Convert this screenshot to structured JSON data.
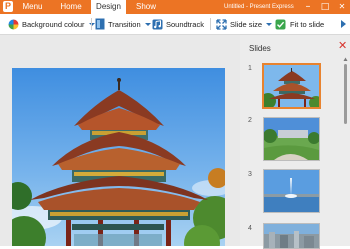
{
  "app": {
    "icon_letter": "P",
    "window_title": "Untitled - Present Express",
    "accent": "#ec7424"
  },
  "menu": {
    "tabs": [
      {
        "label": "Menu"
      },
      {
        "label": "Home"
      },
      {
        "label": "Design",
        "active": true
      },
      {
        "label": "Show"
      }
    ]
  },
  "window_controls": {
    "minimize": "–",
    "maximize": "□",
    "close": "✕"
  },
  "toolbar": {
    "background_colour": {
      "label": "Background colour",
      "icon": "palette-icon"
    },
    "transition": {
      "label": "Transition",
      "icon": "transition-icon"
    },
    "soundtrack": {
      "label": "Soundtrack",
      "icon": "music-icon"
    },
    "slide_size": {
      "label": "Slide size",
      "icon": "resize-arrows-icon"
    },
    "fit_to_slide": {
      "label": "Fit to slide",
      "icon": "checkmark-icon"
    }
  },
  "slides_panel": {
    "title": "Slides",
    "close": "✕",
    "slides": [
      {
        "number": "1",
        "subject": "pagoda",
        "selected": true
      },
      {
        "number": "2",
        "subject": "park"
      },
      {
        "number": "3",
        "subject": "fountain"
      },
      {
        "number": "4",
        "subject": "city"
      }
    ]
  }
}
